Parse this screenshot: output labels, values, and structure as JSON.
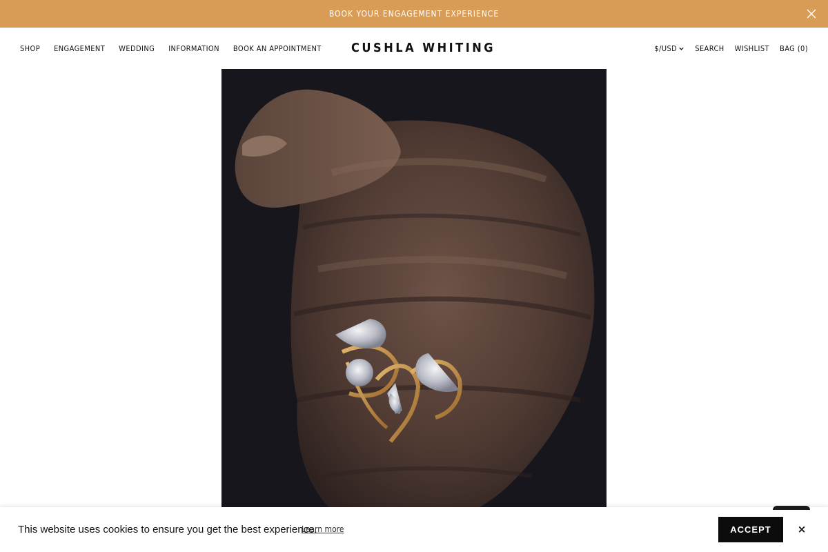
{
  "announcement": {
    "text": "BOOK YOUR ENGAGEMENT EXPERIENCE",
    "background": "#d89c56",
    "close_icon": "close-icon"
  },
  "header": {
    "logo": "CUSHLA WHITING",
    "nav_left": {
      "shop": "SHOP",
      "engagement": "ENGAGEMENT",
      "wedding": "WEDDING",
      "information": "INFORMATION",
      "book": "BOOK AN APPOINTMENT"
    },
    "nav_right": {
      "currency": "$/USD",
      "currency_icon": "chevron-down-icon",
      "search": "SEARCH",
      "wishlist": "WISHLIST",
      "bag": "BAG (0)"
    }
  },
  "hero": {
    "image": "clenched-fist-with-gold-diamond-rings-photo",
    "background": "#17161c"
  },
  "cookie_banner": {
    "message": "This website uses cookies to ensure you get the best experience.",
    "learn_more": "Learn more",
    "accept": "ACCEPT",
    "close": "×"
  }
}
